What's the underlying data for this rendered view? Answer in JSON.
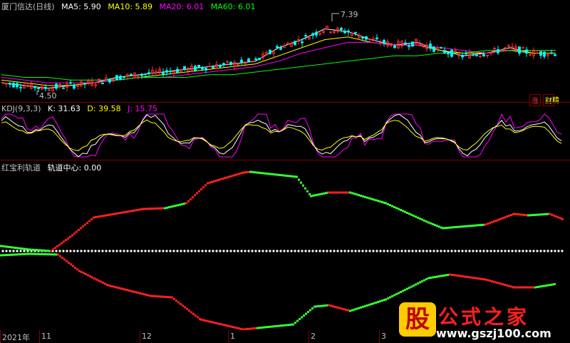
{
  "main_panel": {
    "title": "厦门信达(日线)",
    "ma5": "MA5: 5.90",
    "ma10": "MA10: 5.89",
    "ma20": "MA20: 6.01",
    "ma60": "MA60: 6.01",
    "high_label": "7.39",
    "low_label": "4.50",
    "btn_up": "涨",
    "btn_fin": "财",
    "btn_fin2": "精"
  },
  "kdj_panel": {
    "title": "KDJ(9,3,3)",
    "k": "K: 31.63",
    "d": "D: 39.58",
    "j": "J: 15.75"
  },
  "channel_panel": {
    "title": "红宝利轨道",
    "center": "轨道中心: 0.00"
  },
  "xaxis": {
    "labels": [
      "2021年",
      "11",
      "12",
      "1",
      "2",
      "3"
    ]
  },
  "watermark": {
    "mark": "股",
    "cn": "公式之家",
    "url": "www.gszj100.com"
  },
  "colors": {
    "ma5": "#ffffff",
    "ma10": "#ffff00",
    "ma20": "#ff00ff",
    "ma60": "#00ff00",
    "up": "#ff3030",
    "down": "#00ffff",
    "k": "#ffffff",
    "d": "#ffff00",
    "j": "#ff00ff",
    "rail_red": "#ff2020",
    "rail_green": "#33ff33"
  },
  "chart_data": {
    "type": "line",
    "price_range": [
      4.5,
      7.39
    ],
    "series": [
      {
        "name": "MA5",
        "values": [
          4.8,
          4.7,
          4.6,
          4.7,
          4.8,
          5.0,
          5.1,
          5.2,
          5.3,
          5.4,
          5.5,
          5.6,
          6.1,
          6.4,
          6.8,
          6.7,
          6.4,
          6.2,
          6.3,
          6.0,
          5.8,
          5.9,
          6.1,
          5.9,
          5.9
        ]
      },
      {
        "name": "MA10",
        "values": [
          4.9,
          4.8,
          4.7,
          4.7,
          4.8,
          4.9,
          5.0,
          5.1,
          5.2,
          5.3,
          5.4,
          5.5,
          5.8,
          6.1,
          6.4,
          6.5,
          6.3,
          6.2,
          6.2,
          6.0,
          5.9,
          5.9,
          6.0,
          5.9,
          5.9
        ]
      },
      {
        "name": "MA20",
        "values": [
          5.0,
          4.9,
          4.8,
          4.8,
          4.8,
          4.9,
          5.0,
          5.0,
          5.1,
          5.2,
          5.3,
          5.4,
          5.6,
          5.9,
          6.1,
          6.3,
          6.3,
          6.2,
          6.2,
          6.1,
          6.0,
          5.9,
          6.0,
          6.0,
          6.0
        ]
      },
      {
        "name": "MA60",
        "values": [
          5.1,
          5.0,
          5.0,
          4.9,
          4.9,
          4.9,
          5.0,
          5.0,
          5.0,
          5.1,
          5.1,
          5.2,
          5.3,
          5.4,
          5.5,
          5.6,
          5.7,
          5.8,
          5.8,
          5.9,
          5.9,
          6.0,
          6.0,
          6.0,
          6.0
        ]
      }
    ]
  }
}
